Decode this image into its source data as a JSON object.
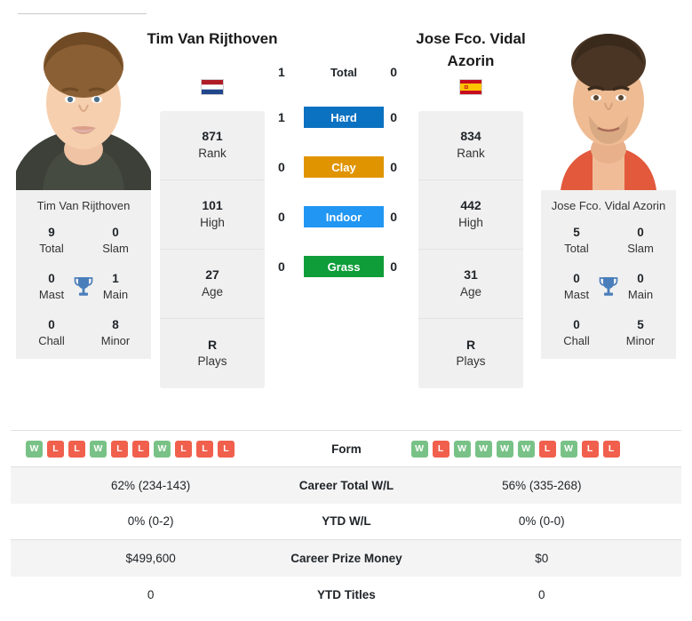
{
  "players": {
    "left": {
      "display_name": "Tim Van Rijthoven",
      "card_name": "Tim Van Rijthoven",
      "country": "Netherlands",
      "flag_icon": "flag-netherlands-icon",
      "stats": [
        {
          "value": "871",
          "label": "Rank"
        },
        {
          "value": "101",
          "label": "High"
        },
        {
          "value": "27",
          "label": "Age"
        },
        {
          "value": "R",
          "label": "Plays"
        }
      ],
      "titles": [
        {
          "value": "9",
          "label": "Total"
        },
        {
          "value": "0",
          "label": "Slam"
        },
        {
          "value": "0",
          "label": "Mast"
        },
        {
          "value": "1",
          "label": "Main"
        },
        {
          "value": "0",
          "label": "Chall"
        },
        {
          "value": "8",
          "label": "Minor"
        }
      ],
      "form": [
        "W",
        "L",
        "L",
        "W",
        "L",
        "L",
        "W",
        "L",
        "L",
        "L"
      ],
      "career_total_wl": "62% (234-143)",
      "ytd_wl": "0% (0-2)",
      "career_prize_money": "$499,600",
      "ytd_titles": "0"
    },
    "right": {
      "display_name": "Jose Fco. Vidal Azorin",
      "card_name": "Jose Fco. Vidal Azorin",
      "country": "Spain",
      "flag_icon": "flag-spain-icon",
      "stats": [
        {
          "value": "834",
          "label": "Rank"
        },
        {
          "value": "442",
          "label": "High"
        },
        {
          "value": "31",
          "label": "Age"
        },
        {
          "value": "R",
          "label": "Plays"
        }
      ],
      "titles": [
        {
          "value": "5",
          "label": "Total"
        },
        {
          "value": "0",
          "label": "Slam"
        },
        {
          "value": "0",
          "label": "Mast"
        },
        {
          "value": "0",
          "label": "Main"
        },
        {
          "value": "0",
          "label": "Chall"
        },
        {
          "value": "5",
          "label": "Minor"
        }
      ],
      "form": [
        "W",
        "L",
        "W",
        "W",
        "W",
        "W",
        "L",
        "W",
        "L",
        "L"
      ],
      "career_total_wl": "56% (335-268)",
      "ytd_wl": "0% (0-0)",
      "career_prize_money": "$0",
      "ytd_titles": "0"
    }
  },
  "head_to_head": {
    "rows": [
      {
        "label": "Total",
        "left": "1",
        "right": "0",
        "badge": false,
        "color": ""
      },
      {
        "label": "Hard",
        "left": "1",
        "right": "0",
        "badge": true,
        "color": "#0b71c1"
      },
      {
        "label": "Clay",
        "left": "0",
        "right": "0",
        "badge": true,
        "color": "#e09400"
      },
      {
        "label": "Indoor",
        "left": "0",
        "right": "0",
        "badge": true,
        "color": "#2196f3"
      },
      {
        "label": "Grass",
        "left": "0",
        "right": "0",
        "badge": true,
        "color": "#0f9d3a"
      }
    ]
  },
  "comparison_table": {
    "rows": [
      {
        "label": "Form",
        "type": "form"
      },
      {
        "label": "Career Total W/L",
        "type": "text",
        "key": "career_total_wl"
      },
      {
        "label": "YTD W/L",
        "type": "text",
        "key": "ytd_wl"
      },
      {
        "label": "Career Prize Money",
        "type": "text",
        "key": "career_prize_money"
      },
      {
        "label": "YTD Titles",
        "type": "text",
        "key": "ytd_titles"
      }
    ]
  },
  "icons": {
    "trophy": "trophy-icon",
    "trophy_color": "#4a7ebb"
  },
  "colors": {
    "win_badge": "#79c287",
    "loss_badge": "#f0604d",
    "card_bg": "#f0f0f0",
    "row_shade": "#f4f4f4"
  }
}
